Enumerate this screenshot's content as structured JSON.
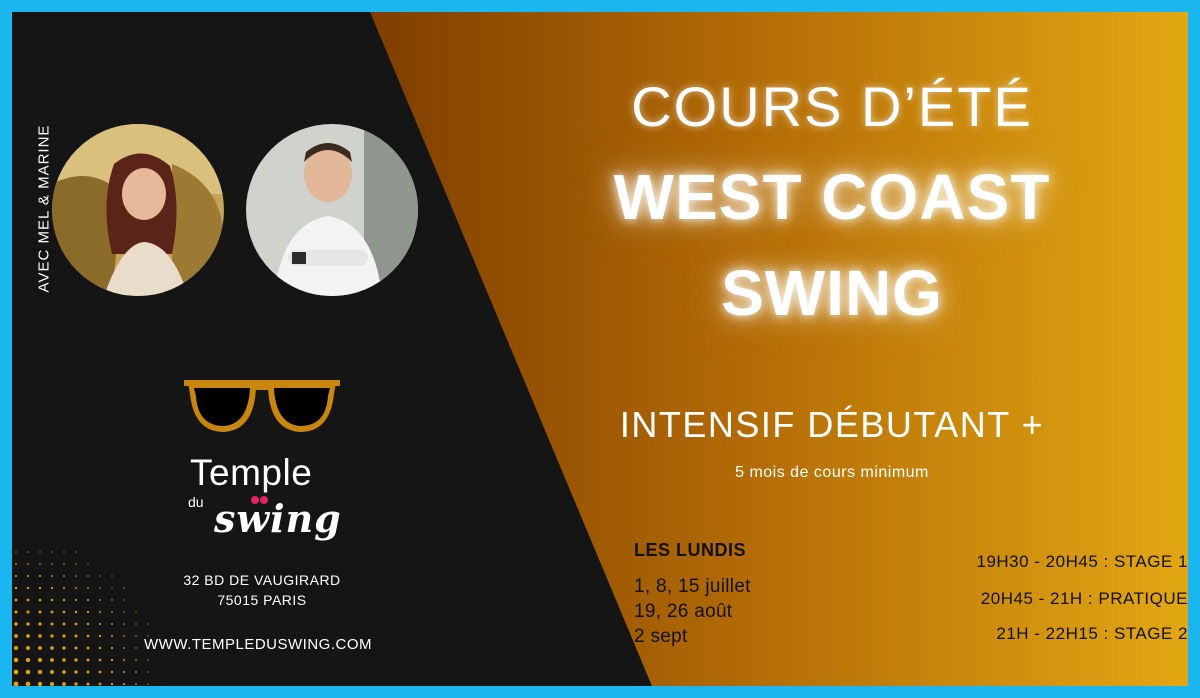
{
  "left": {
    "side_label": "AVEC MEL & MARINE",
    "brand_main": "Temple",
    "brand_du": "du",
    "brand_swing": "swing",
    "address_line1": "32 BD DE VAUGIRARD",
    "address_line2": "75015  PARIS",
    "website": "WWW.TEMPLEDUSWING.COM"
  },
  "right": {
    "title_line1": "COURS D’ÉTÉ",
    "title_line2": "WEST COAST",
    "title_line3": "SWING",
    "subtitle": "INTENSIF DÉBUTANT +",
    "minimum": "5 mois de cours minimum",
    "days_title": "LES LUNDIS",
    "dates": [
      "1, 8, 15 juillet",
      "19, 26 août",
      "2 sept"
    ],
    "schedule": [
      "19H30 - 20H45 : STAGE 1",
      "20H45 - 21H : PRATIQUE",
      "21H - 22H15 : STAGE 2"
    ]
  },
  "colors": {
    "frame": "#19b6ef",
    "dark": "#151515",
    "gradient_start": "#8a4500",
    "gradient_end": "#e0a010",
    "glasses_frame": "#c9860e",
    "heart_red": "#e0245e"
  },
  "icons": [
    "sunglasses-icon",
    "avatar-woman",
    "avatar-man",
    "dot-pattern"
  ]
}
